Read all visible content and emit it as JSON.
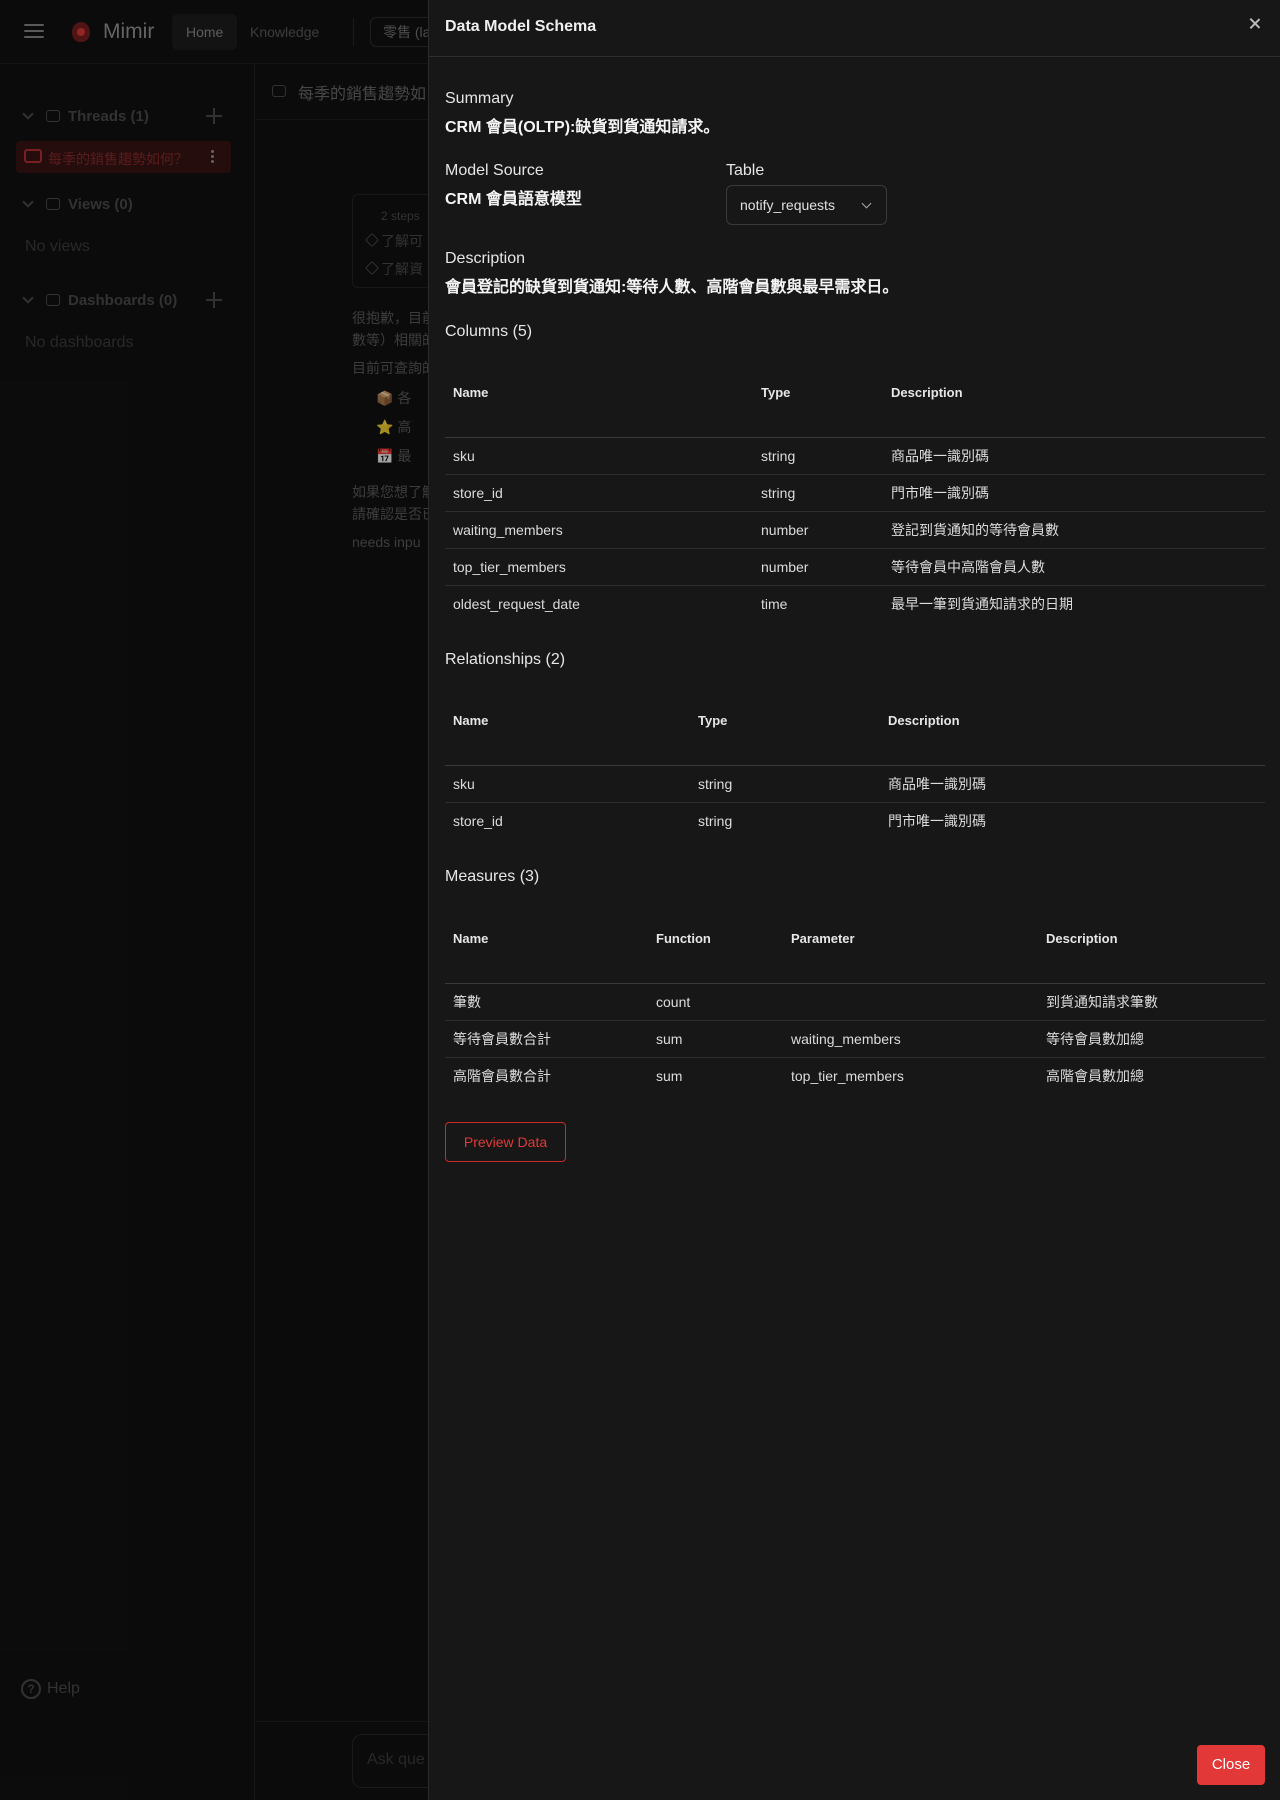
{
  "topbar": {
    "brand": "Mimir",
    "nav": {
      "home": "Home",
      "knowledge": "Knowledge"
    },
    "db_selector": "零售 (la"
  },
  "sidebar": {
    "threads": {
      "header": "Threads (1)",
      "items": [
        {
          "label": "每季的銷售趨勢如何？"
        }
      ]
    },
    "views": {
      "header": "Views (0)",
      "empty": "No views"
    },
    "dashboards": {
      "header": "Dashboards (0)",
      "empty": "No dashboards"
    },
    "help": "Help"
  },
  "main": {
    "thread_title": "每季的銷售趨勢如",
    "steps": {
      "summary": "2 steps",
      "step1": "了解可",
      "step2": "了解資"
    },
    "messages": {
      "line1": "很抱歉，目前",
      "line2": "數等）相關的",
      "line3": "目前可查詢的",
      "bullet1": "📦 各",
      "bullet2": "⭐ 高",
      "bullet3": "📅 最",
      "line4": "如果您想了解",
      "line5": "請確認是否已",
      "status": "needs inpu"
    },
    "ask_placeholder": "Ask que"
  },
  "drawer": {
    "title": "Data Model Schema",
    "summary_label": "Summary",
    "summary_value": "CRM 會員(OLTP):缺貨到貨通知請求。",
    "model_source_label": "Model Source",
    "model_source_value": "CRM 會員語意模型",
    "table_label": "Table",
    "table_value": "notify_requests",
    "description_label": "Description",
    "description_value": "會員登記的缺貨到貨通知:等待人數、高階會員數與最早需求日。",
    "columns": {
      "title": "Columns (5)",
      "headers": [
        "Name",
        "Type",
        "Description"
      ],
      "rows": [
        [
          "sku",
          "string",
          "商品唯一識別碼"
        ],
        [
          "store_id",
          "string",
          "門市唯一識別碼"
        ],
        [
          "waiting_members",
          "number",
          "登記到貨通知的等待會員數"
        ],
        [
          "top_tier_members",
          "number",
          "等待會員中高階會員人數"
        ],
        [
          "oldest_request_date",
          "time",
          "最早一筆到貨通知請求的日期"
        ]
      ]
    },
    "relationships": {
      "title": "Relationships (2)",
      "headers": [
        "Name",
        "Type",
        "Description"
      ],
      "rows": [
        [
          "sku",
          "string",
          "商品唯一識別碼"
        ],
        [
          "store_id",
          "string",
          "門市唯一識別碼"
        ]
      ]
    },
    "measures": {
      "title": "Measures (3)",
      "headers": [
        "Name",
        "Function",
        "Parameter",
        "Description"
      ],
      "rows": [
        [
          "筆數",
          "count",
          "",
          "到貨通知請求筆數"
        ],
        [
          "等待會員數合計",
          "sum",
          "waiting_members",
          "等待會員數加總"
        ],
        [
          "高階會員數合計",
          "sum",
          "top_tier_members",
          "高階會員數加總"
        ]
      ]
    },
    "preview_button": "Preview Data",
    "close_button": "Close"
  }
}
